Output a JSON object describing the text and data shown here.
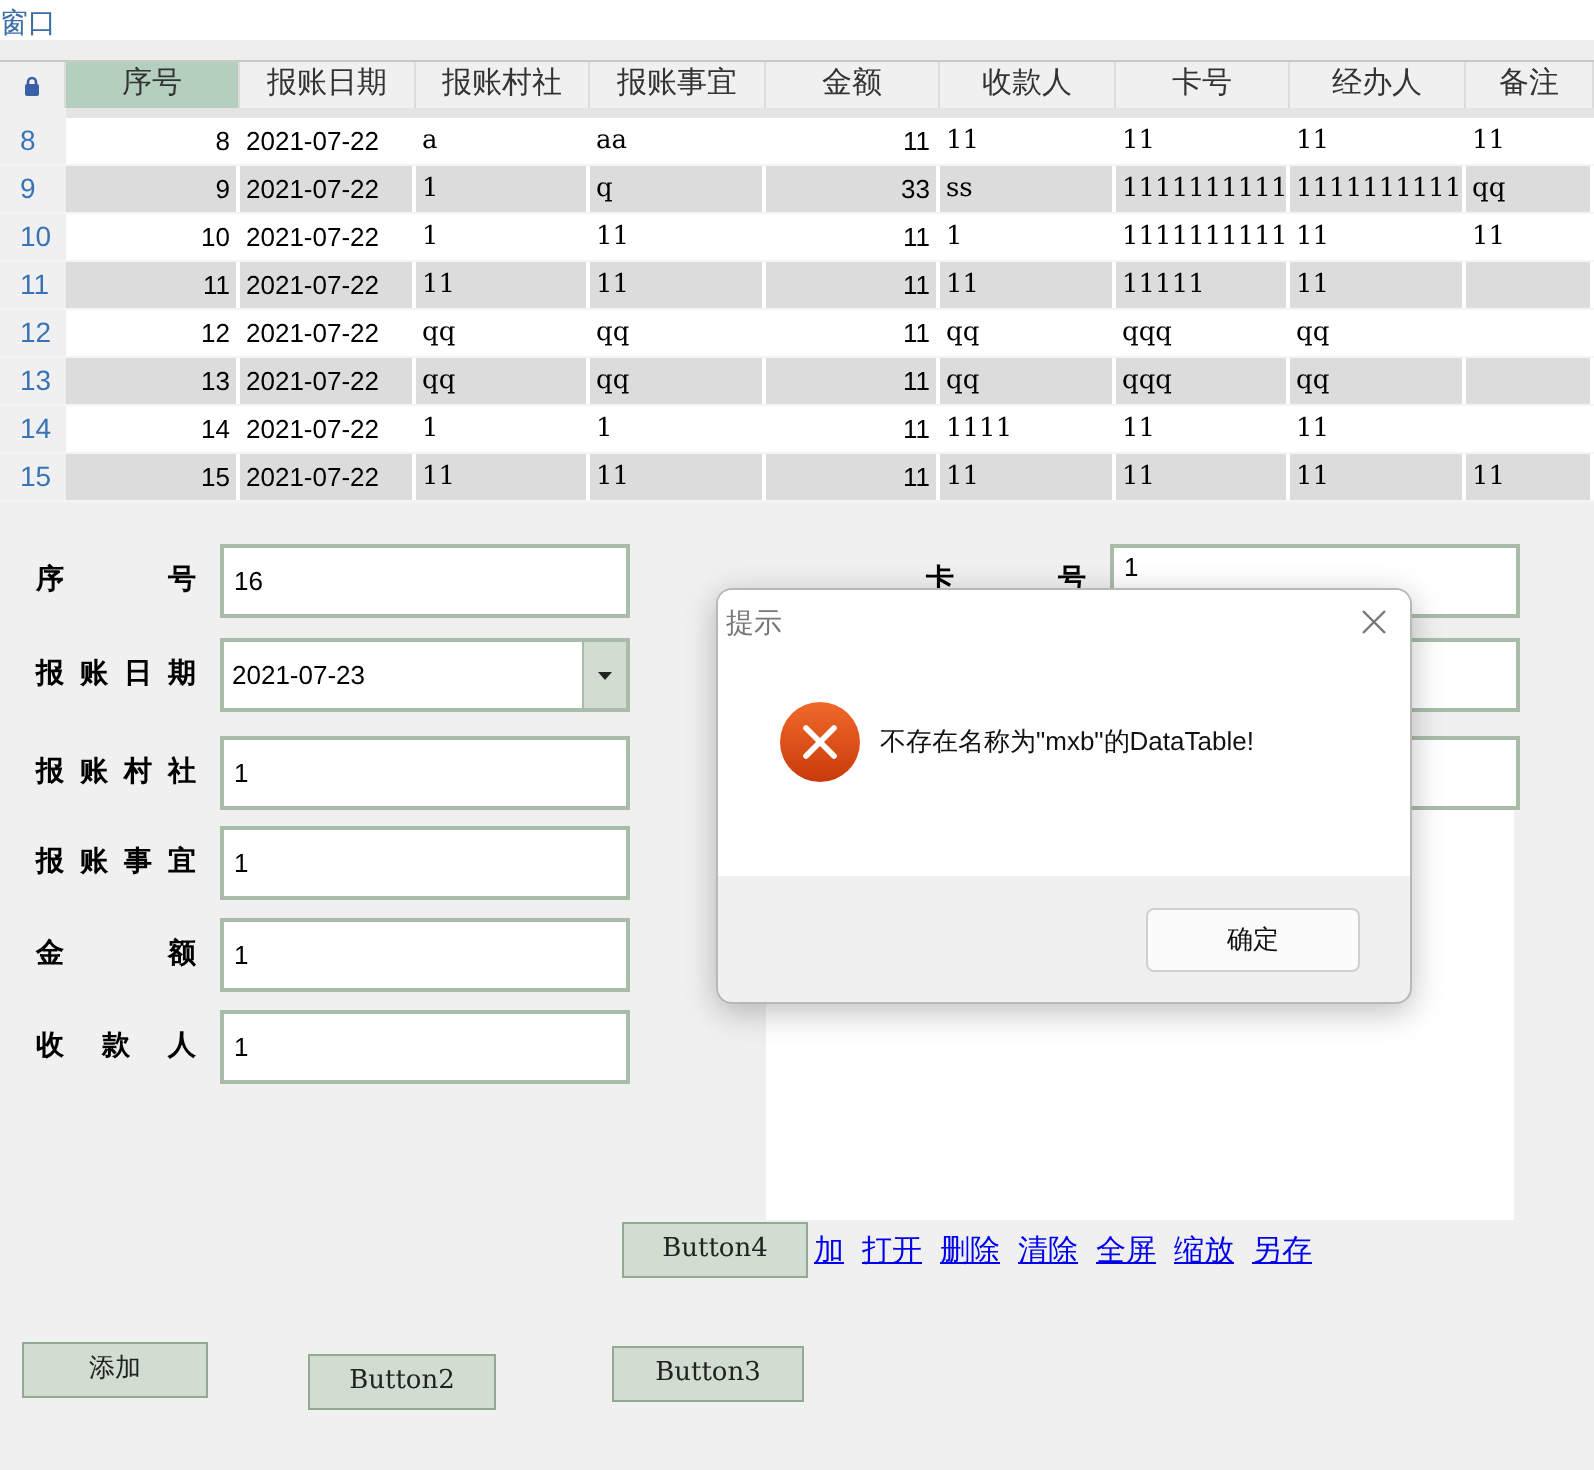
{
  "window": {
    "title": "窗口"
  },
  "table": {
    "columns": [
      {
        "label": "序号",
        "selected": true
      },
      {
        "label": "报账日期",
        "selected": false
      },
      {
        "label": "报账村社",
        "selected": false
      },
      {
        "label": "报账事宜",
        "selected": false
      },
      {
        "label": "金额",
        "selected": false
      },
      {
        "label": "收款人",
        "selected": false
      },
      {
        "label": "卡号",
        "selected": false
      },
      {
        "label": "经办人",
        "selected": false
      },
      {
        "label": "备注",
        "selected": false
      }
    ],
    "rows": [
      {
        "row_number": "8",
        "cells": [
          "8",
          "2021-07-22",
          "a",
          "aa",
          "11",
          "11",
          "11",
          "11",
          "11"
        ]
      },
      {
        "row_number": "9",
        "cells": [
          "9",
          "2021-07-22",
          "1",
          "q",
          "33",
          "ss",
          "1111111111",
          "1111111111",
          "qq"
        ]
      },
      {
        "row_number": "10",
        "cells": [
          "10",
          "2021-07-22",
          "1",
          "11",
          "11",
          "1",
          "1111111111",
          "11",
          "11"
        ]
      },
      {
        "row_number": "11",
        "cells": [
          "11",
          "2021-07-22",
          "11",
          "11",
          "11",
          "11",
          "11111",
          "11"
        ]
      },
      {
        "row_number": "12",
        "cells": [
          "12",
          "2021-07-22",
          "qq",
          "qq",
          "11",
          "qq",
          "qqq",
          "qq"
        ]
      },
      {
        "row_number": "13",
        "cells": [
          "13",
          "2021-07-22",
          "qq",
          "qq",
          "11",
          "qq",
          "qqq",
          "qq"
        ]
      },
      {
        "row_number": "14",
        "cells": [
          "14",
          "2021-07-22",
          "1",
          "1",
          "11",
          "1111",
          "11",
          "11"
        ]
      },
      {
        "row_number": "15",
        "cells": [
          "15",
          "2021-07-22",
          "11",
          "11",
          "11",
          "11",
          "11",
          "11",
          "11"
        ]
      }
    ]
  },
  "form_fields": [
    {
      "label": "序号",
      "value": "16",
      "kind": "text"
    },
    {
      "label": "报账日期",
      "value": "2021-07-23",
      "kind": "dropdown"
    },
    {
      "label": "报账村社",
      "value": "1",
      "kind": "text"
    },
    {
      "label": "报账事宜",
      "value": "1",
      "kind": "text"
    },
    {
      "label": "金额",
      "value": "1",
      "kind": "text"
    },
    {
      "label": "收款人",
      "value": "1",
      "kind": "text"
    }
  ],
  "right_fields": [
    {
      "label": "卡号",
      "value": "1",
      "kind": "text"
    },
    {
      "kind": "blank"
    },
    {
      "kind": "blank"
    }
  ],
  "links": [
    "加",
    "打开",
    "删除",
    "清除",
    "全屏",
    "缩放",
    "另存"
  ],
  "buttons": [
    {
      "label": "Button4"
    },
    {
      "label": "添加"
    },
    {
      "label": "Button2"
    },
    {
      "label": "Button3"
    }
  ],
  "dialog": {
    "title": "提示",
    "message": "不存在名称为\"mxb\"的DataTable!",
    "button": "确定"
  }
}
